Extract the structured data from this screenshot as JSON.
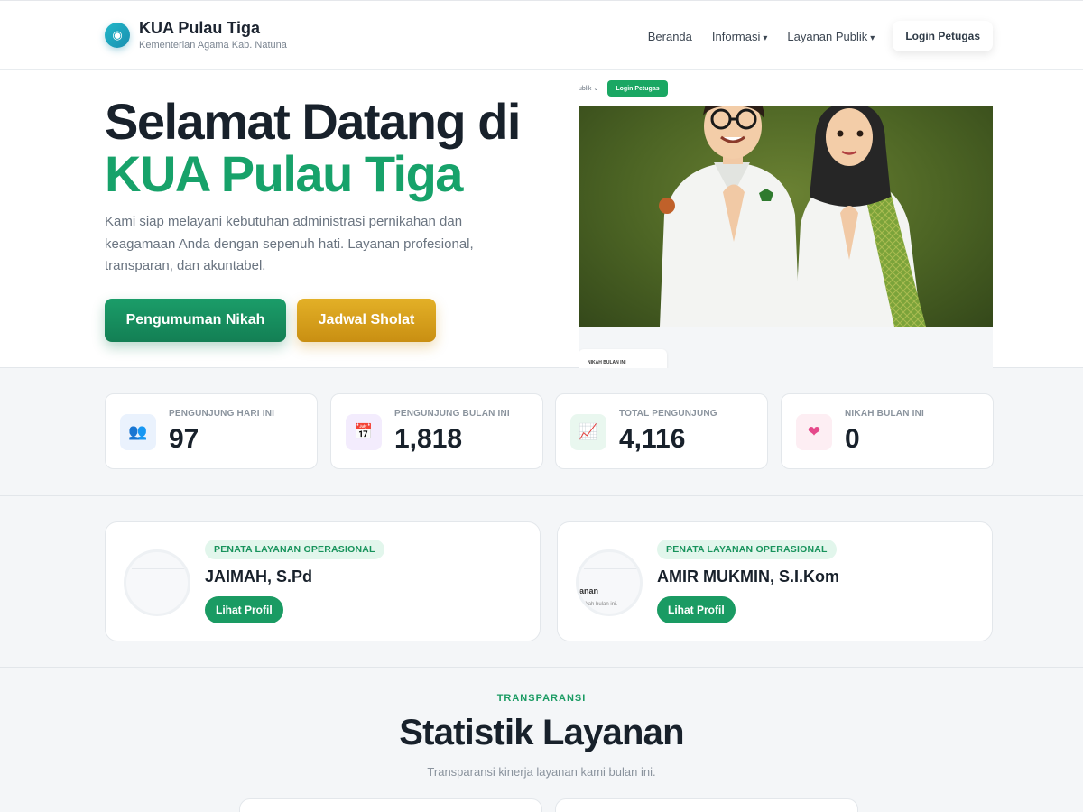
{
  "brand": {
    "title": "KUA Pulau Tiga",
    "subtitle": "Kementerian Agama Kab. Natuna",
    "logo_icon": "circle-dot-icon"
  },
  "nav": {
    "items": [
      {
        "label": "Beranda",
        "has_dropdown": false
      },
      {
        "label": "Informasi",
        "has_dropdown": true
      },
      {
        "label": "Layanan Publik",
        "has_dropdown": true
      }
    ],
    "login_label": "Login Petugas"
  },
  "hero": {
    "title_line1": "Selamat Datang di",
    "title_line2": "KUA Pulau Tiga",
    "description": "Kami siap melayani kebutuhan administrasi pernikahan dan keagamaan Anda dengan sepenuh hati. Layanan profesional, transparan, dan akuntabel.",
    "btn_primary": "Pengumuman Nikah",
    "btn_secondary": "Jadwal Sholat",
    "preview": {
      "top_text": "ublik ⌄",
      "login_label": "Login Petugas",
      "card_label": "NIKAH BULAN INI"
    }
  },
  "stats": [
    {
      "label": "PENGUNJUNG HARI INI",
      "value": "97",
      "icon": "users-icon",
      "icon_glyph": "👥",
      "icon_bg": "#eaf2fd"
    },
    {
      "label": "PENGUNJUNG BULAN INI",
      "value": "1,818",
      "icon": "calendar-icon",
      "icon_glyph": "📅",
      "icon_bg": "#f3ecfd"
    },
    {
      "label": "TOTAL PENGUNJUNG",
      "value": "4,116",
      "icon": "chart-up-icon",
      "icon_glyph": "📈",
      "icon_bg": "#e9f7ef"
    },
    {
      "label": "NIKAH BULAN INI",
      "value": "0",
      "icon": "heart-icon",
      "icon_glyph": "❤",
      "icon_bg": "#fdeef3"
    }
  ],
  "staff": [
    {
      "role": "PENATA LAYANAN OPERASIONAL",
      "name": "JAIMAH, S.Pd",
      "button": "Lihat Profil",
      "avatar_text1": "",
      "avatar_text2": ""
    },
    {
      "role": "PENATA LAYANAN OPERASIONAL",
      "name": "AMIR MUKMIN, S.I.Kom",
      "button": "Lihat Profil",
      "avatar_text1": "anan",
      "avatar_text2": "nikah bulan ini."
    }
  ],
  "statistics": {
    "eyebrow": "TRANSPARANSI",
    "title": "Statistik Layanan",
    "subtitle": "Transparansi kinerja layanan kami bulan ini."
  },
  "colors": {
    "accent_green": "#17a26a",
    "accent_gold": "#d9a01c",
    "dark_text": "#18212b"
  }
}
